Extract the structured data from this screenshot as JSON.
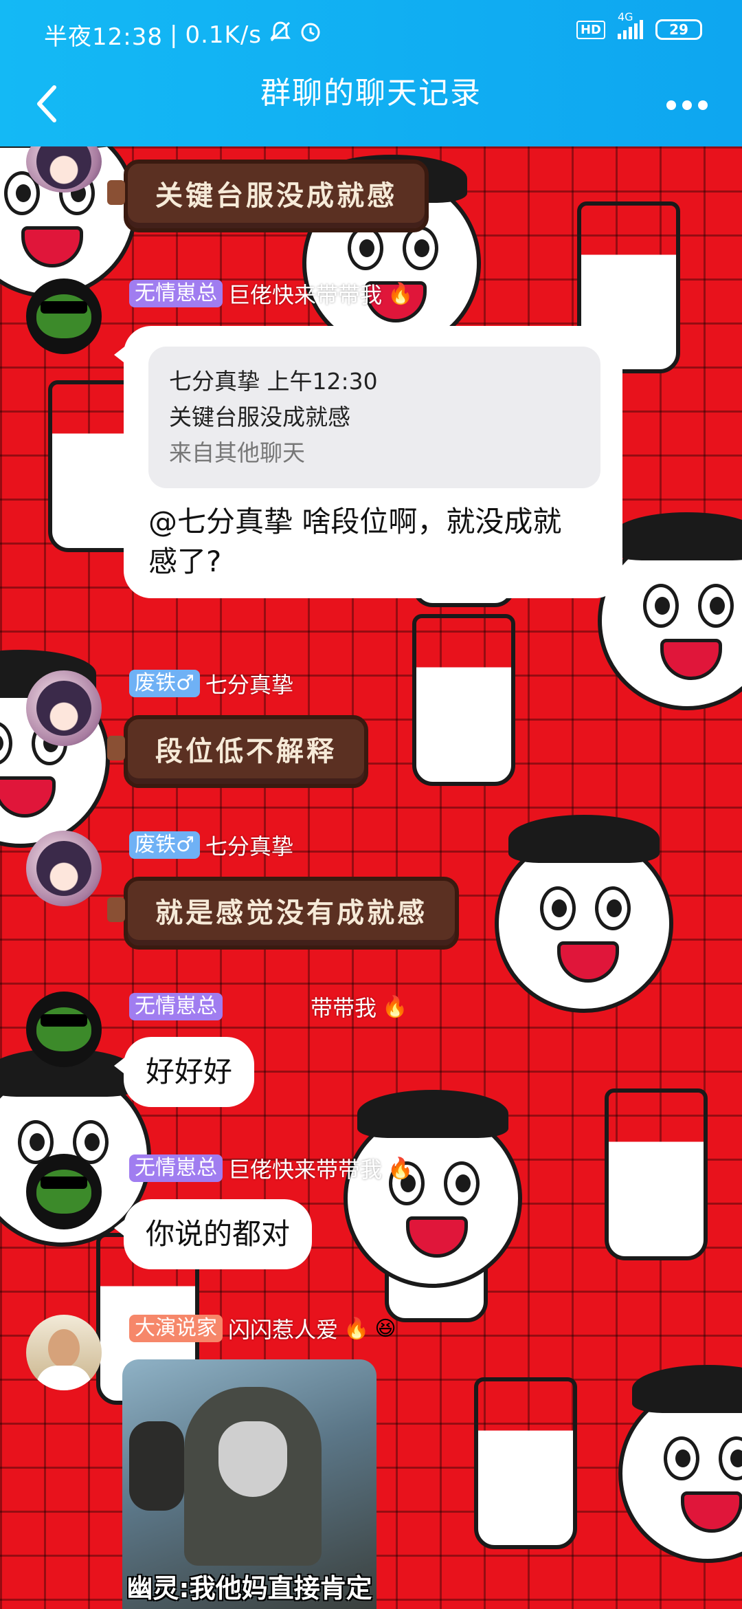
{
  "status_bar": {
    "time": "半夜12:38",
    "separator": "|",
    "network_speed": "0.1K/s",
    "network_type": "4G",
    "hd_label": "HD",
    "battery": "29"
  },
  "header": {
    "title": "群聊的聊天记录",
    "back_icon": "chevron-left-icon",
    "more_icon": "more-dots-icon"
  },
  "messages": [
    {
      "id": "m1",
      "type": "choco",
      "text": "关键台服没成就感"
    },
    {
      "id": "m2",
      "badge": "无情崽总",
      "nickname": "巨佬快来带带我",
      "nick_emoji": "🔥",
      "type": "reply",
      "quote_header": "七分真挚 上午12:30",
      "quote_text": "关键台服没成就感",
      "quote_source": "来自其他聊天",
      "text_line1": "@七分真挚 啥段位啊，就没成就",
      "text_line2": "感了?"
    },
    {
      "id": "m3",
      "badge": "废铁♂",
      "nickname": "七分真挚",
      "type": "choco",
      "text": "段位低不解释"
    },
    {
      "id": "m4",
      "badge": "废铁♂",
      "nickname": "七分真挚",
      "type": "choco",
      "text": "就是感觉没有成就感"
    },
    {
      "id": "m5",
      "badge": "无情崽总",
      "nickname": "带带我",
      "nick_emoji": "🔥",
      "type": "text",
      "text": "好好好"
    },
    {
      "id": "m6",
      "badge": "无情崽总",
      "nickname": "巨佬快来带带我",
      "nick_emoji": "🔥",
      "type": "text",
      "text": "你说的都对"
    },
    {
      "id": "m7",
      "badge": "大演说家",
      "nickname": "闪闪惹人爱",
      "nick_emoji": "🔥",
      "nick_emoji2": "😆",
      "type": "image",
      "image_caption": "幽灵:我他妈直接肯定"
    }
  ]
}
